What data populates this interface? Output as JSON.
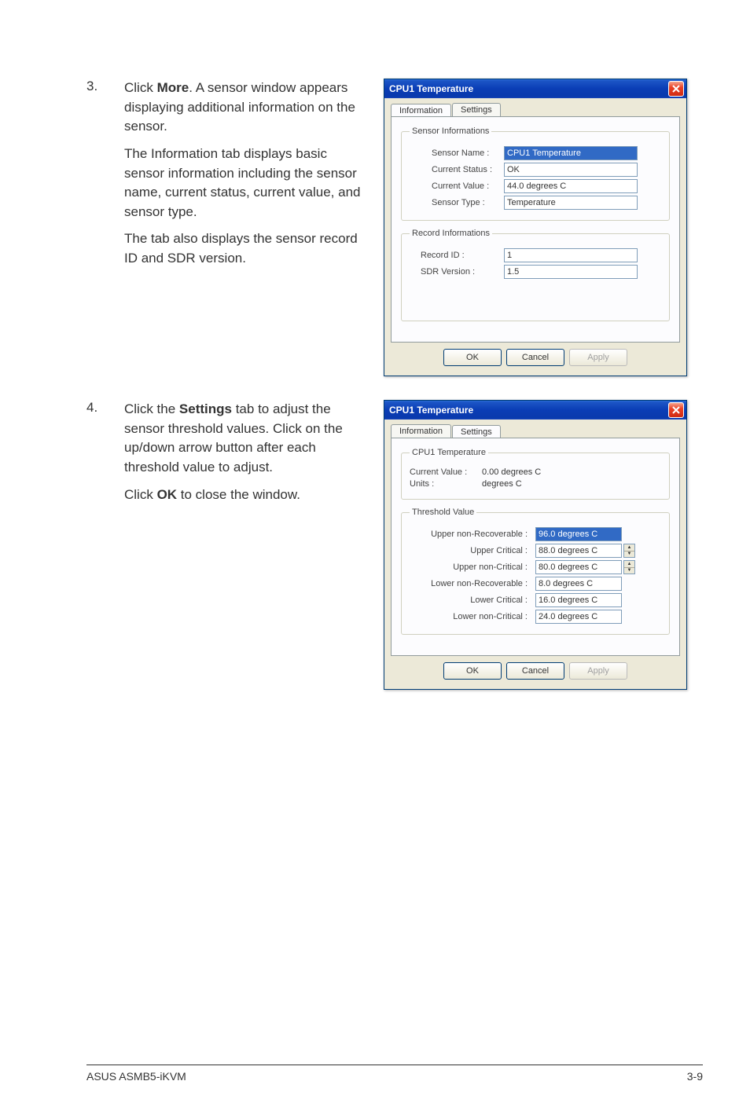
{
  "steps": {
    "s3": {
      "num": "3.",
      "p1a": "Click ",
      "p1b": "More",
      "p1c": ". A sensor window appears displaying additional information on the sensor.",
      "p2": "The Information tab displays basic sensor information including the sensor name, current status, current value, and sensor type.",
      "p3": "The tab also displays the sensor record ID and SDR version."
    },
    "s4": {
      "num": "4.",
      "p1a": "Click the ",
      "p1b": "Settings",
      "p1c": " tab to adjust the sensor threshold values. Click on the up/down arrow button after each threshold value to adjust.",
      "p2a": "Click ",
      "p2b": "OK",
      "p2c": " to close the window."
    }
  },
  "dialog1": {
    "title": "CPU1 Temperature",
    "tab_information": "Information",
    "tab_settings": "Settings",
    "fs1_legend": "Sensor Informations",
    "sensor_name_lbl": "Sensor Name  :",
    "sensor_name_val": "CPU1 Temperature",
    "current_status_lbl": "Current Status :",
    "current_status_val": "OK",
    "current_value_lbl": "Current Value  :",
    "current_value_val": "44.0 degrees C",
    "sensor_type_lbl": "Sensor Type   :",
    "sensor_type_val": "Temperature",
    "fs2_legend": "Record Informations",
    "record_id_lbl": "Record ID      :",
    "record_id_val": "1",
    "sdr_version_lbl": "SDR Version :",
    "sdr_version_val": "1.5",
    "ok": "OK",
    "cancel": "Cancel",
    "apply": "Apply"
  },
  "dialog2": {
    "title": "CPU1 Temperature",
    "tab_information": "Information",
    "tab_settings": "Settings",
    "fs1_legend": "CPU1 Temperature",
    "curr_val_lbl": "Current Value :",
    "curr_val_val": "0.00 degrees C",
    "units_lbl": "Units               :",
    "units_val": "degrees C",
    "fs2_legend": "Threshold Value",
    "unr_lbl": "Upper non-Recoverable :",
    "unr_val": "96.0 degrees C",
    "uc_lbl": "Upper Critical :",
    "uc_val": "88.0 degrees C",
    "unc_lbl": "Upper non-Critical :",
    "unc_val": "80.0 degrees C",
    "lnr_lbl": "Lower non-Recoverable :",
    "lnr_val": "8.0 degrees C",
    "lc_lbl": "Lower Critical :",
    "lc_val": "16.0 degrees C",
    "lnc_lbl": "Lower non-Critical :",
    "lnc_val": "24.0 degrees C",
    "ok": "OK",
    "cancel": "Cancel",
    "apply": "Apply"
  },
  "footer": {
    "left": "ASUS ASMB5-iKVM",
    "right": "3-9"
  }
}
